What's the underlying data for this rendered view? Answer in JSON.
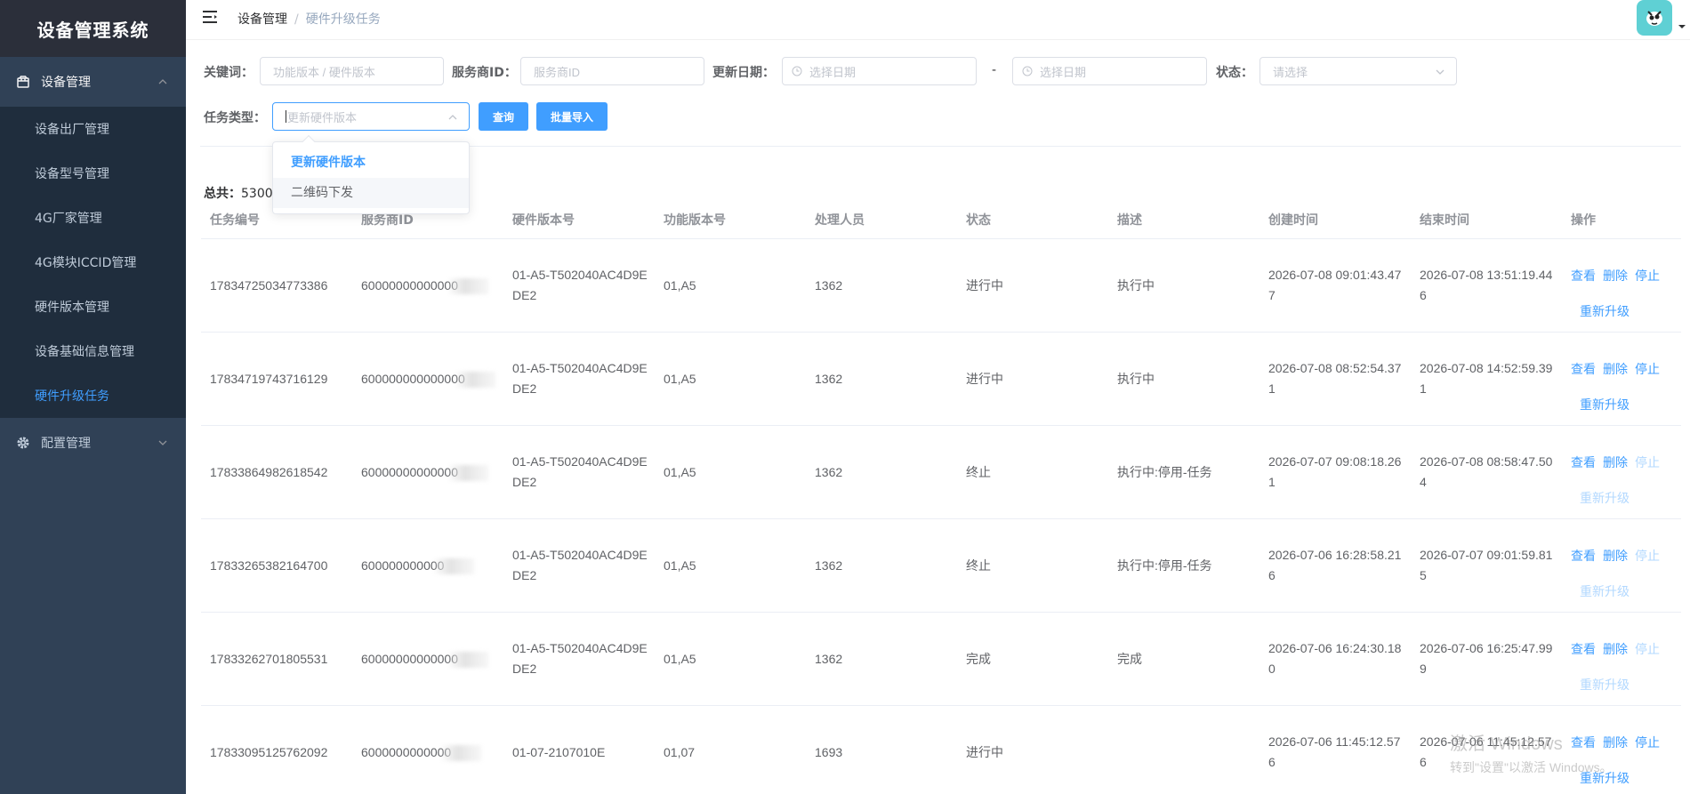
{
  "app": {
    "title": "设备管理系统"
  },
  "sidebar": {
    "group1": {
      "label": "设备管理",
      "icon": "box-icon"
    },
    "items": [
      {
        "label": "设备出厂管理"
      },
      {
        "label": "设备型号管理"
      },
      {
        "label": "4G厂家管理"
      },
      {
        "label": "4G模块ICCID管理"
      },
      {
        "label": "硬件版本管理"
      },
      {
        "label": "设备基础信息管理"
      },
      {
        "label": "硬件升级任务"
      }
    ],
    "group2": {
      "label": "配置管理",
      "icon": "gear-icon"
    }
  },
  "breadcrumb": {
    "root": "设备管理",
    "separator": "/",
    "current": "硬件升级任务"
  },
  "filters": {
    "keyword_label": "关键词：",
    "keyword_placeholder": "功能版本 / 硬件版本",
    "provider_label": "服务商ID：",
    "provider_placeholder": "服务商ID",
    "date_label": "更新日期：",
    "date_start_placeholder": "选择日期",
    "date_sep": "-",
    "date_end_placeholder": "选择日期",
    "status_label": "状态：",
    "status_placeholder": "请选择",
    "type_label": "任务类型：",
    "type_placeholder": "更新硬件版本",
    "query_button": "查询",
    "import_button": "批量导入"
  },
  "dropdown": {
    "options": [
      "更新硬件版本",
      "二维码下发"
    ],
    "selected": "更新硬件版本"
  },
  "total": {
    "label": "总共：",
    "value": "5300条"
  },
  "table": {
    "headers": [
      "任务编号",
      "服务商ID",
      "硬件版本号",
      "功能版本号",
      "处理人员",
      "状态",
      "描述",
      "创建时间",
      "结束时间",
      "操作"
    ],
    "rows": [
      {
        "id": "17834725034773386",
        "provider": "60000000000000",
        "hw": "01-A5-T502040AC4D9EDE2",
        "fw": "01,A5",
        "handler": "1362",
        "status": "进行中",
        "desc": "执行中",
        "created": "2026-07-08 09:01:43.477",
        "ended": "2026-07-08 13:51:19.446"
      },
      {
        "id": "17834719743716129",
        "provider": "600000000000000",
        "hw": "01-A5-T502040AC4D9EDE2",
        "fw": "01,A5",
        "handler": "1362",
        "status": "进行中",
        "desc": "执行中",
        "created": "2026-07-08 08:52:54.371",
        "ended": "2026-07-08 14:52:59.391"
      },
      {
        "id": "17833864982618542",
        "provider": "60000000000000",
        "hw": "01-A5-T502040AC4D9EDE2",
        "fw": "01,A5",
        "handler": "1362",
        "status": "终止",
        "desc": "执行中:停用-任务",
        "created": "2026-07-07 09:08:18.261",
        "ended": "2026-07-08 08:58:47.504"
      },
      {
        "id": "17833265382164700",
        "provider": "600000000000",
        "hw": "01-A5-T502040AC4D9EDE2",
        "fw": "01,A5",
        "handler": "1362",
        "status": "终止",
        "desc": "执行中:停用-任务",
        "created": "2026-07-06 16:28:58.216",
        "ended": "2026-07-07 09:01:59.815"
      },
      {
        "id": "17833262701805531",
        "provider": "60000000000000",
        "hw": "01-A5-T502040AC4D9EDE2",
        "fw": "01,A5",
        "handler": "1362",
        "status": "完成",
        "desc": "完成",
        "created": "2026-07-06 16:24:30.180",
        "ended": "2026-07-06 16:25:47.999"
      },
      {
        "id": "17833095125762092",
        "provider": "6000000000000",
        "hw": "01-07-2107010E",
        "fw": "01,07",
        "handler": "1693",
        "status": "进行中",
        "desc": "",
        "created": "2026-07-06 11:45:12.576",
        "ended": "2026-07-06 11:45:12.576"
      }
    ],
    "ops": {
      "view": "查看",
      "delete": "删除",
      "stop": "停止",
      "retry": "重新升级"
    }
  },
  "watermark": {
    "line1": "激活 Windows",
    "line2": "转到\"设置\"以激活 Windows。"
  },
  "colors": {
    "accent": "#409eff",
    "sidebar": "#304156",
    "submenu": "#1f2d3d"
  }
}
